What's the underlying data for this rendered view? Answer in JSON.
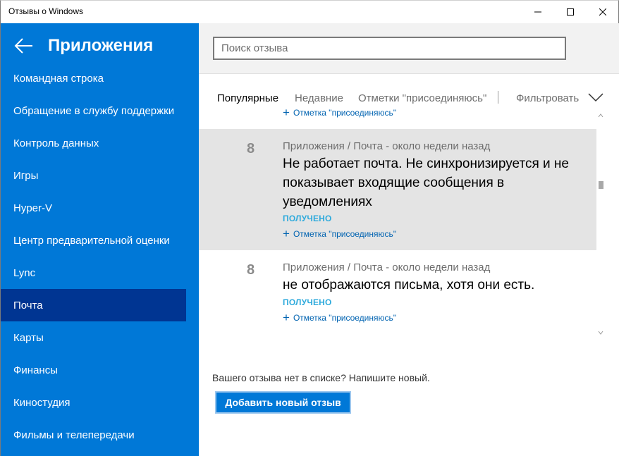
{
  "window": {
    "title": "Отзывы о Windows"
  },
  "sidebar": {
    "title": "Приложения",
    "items": [
      {
        "label": "Командная строка"
      },
      {
        "label": "Обращение в службу поддержки"
      },
      {
        "label": "Контроль данных"
      },
      {
        "label": "Игры"
      },
      {
        "label": "Hyper-V"
      },
      {
        "label": "Центр предварительной оценки"
      },
      {
        "label": "Lync"
      },
      {
        "label": "Почта",
        "selected": true
      },
      {
        "label": "Карты"
      },
      {
        "label": "Финансы"
      },
      {
        "label": "Киностудия"
      },
      {
        "label": "Фильмы и телепередачи"
      }
    ]
  },
  "search": {
    "placeholder": "Поиск отзыва",
    "value": ""
  },
  "tabs": {
    "popular": "Популярные",
    "recent": "Недавние",
    "upvoted": "Отметки \"присоединяюсь\"",
    "separator": "|",
    "filter": "Фильтровать",
    "selected": "popular"
  },
  "feedback": {
    "partial_upvote": "Отметка \"присоединяюсь\"",
    "items": [
      {
        "votes": "8",
        "meta": "Приложения / Почта - около недели назад",
        "title": "Не работает почта. Не синхронизируется и не показывает входящие сообщения в уведомлениях",
        "status": "ПОЛУЧЕНО",
        "upvote": "Отметка \"присоединяюсь\""
      },
      {
        "votes": "8",
        "meta": "Приложения / Почта - около недели назад",
        "title": "не отображаются письма, хотя они есть.",
        "status": "ПОЛУЧЕНО",
        "upvote": "Отметка \"присоединяюсь\""
      }
    ]
  },
  "footer": {
    "prompt": "Вашего отзыва нет в списке? Напишите новый.",
    "add_button": "Добавить новый отзыв"
  },
  "colors": {
    "accent": "#0078d7",
    "sidebar_selected": "#003592",
    "status": "#2eaadc",
    "link": "#0063b1"
  }
}
